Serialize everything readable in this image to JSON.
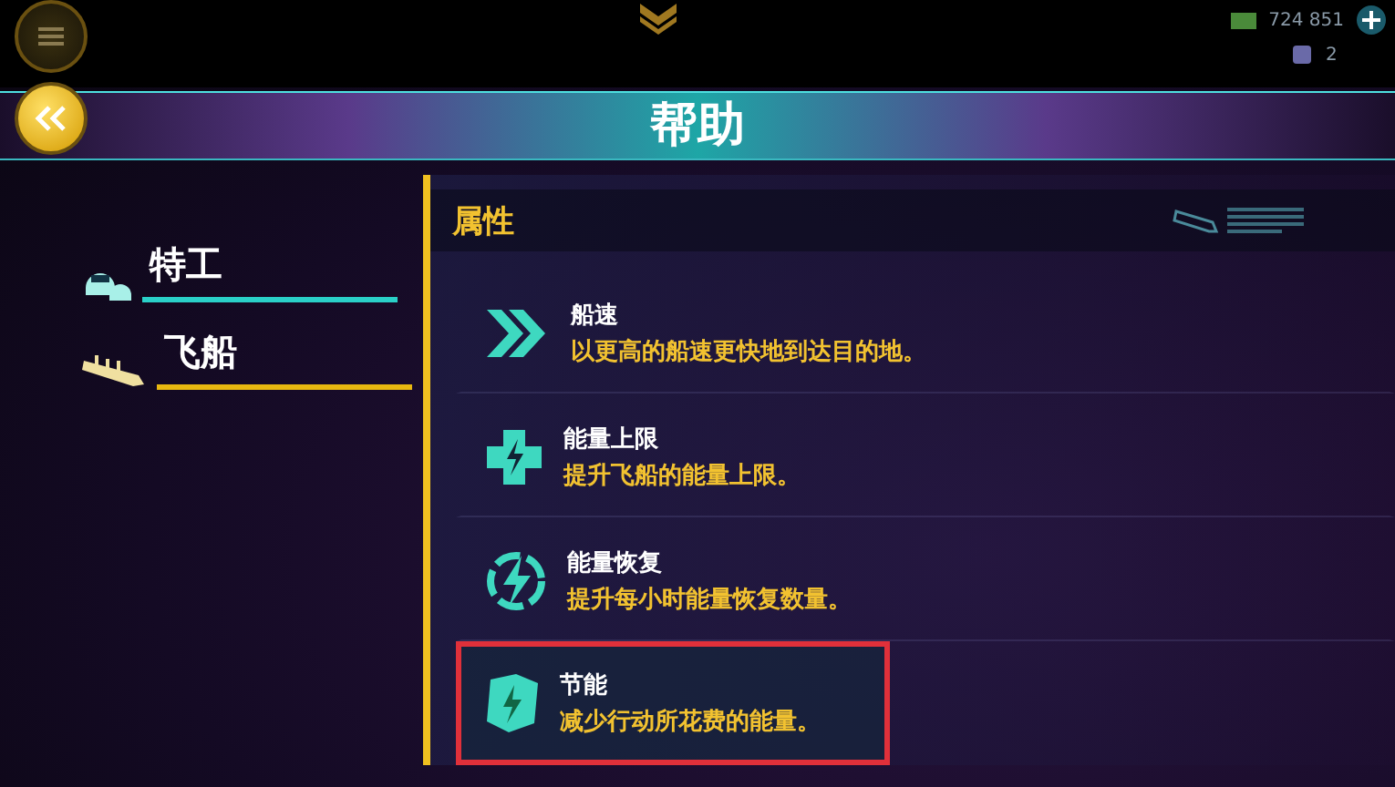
{
  "top_bar": {
    "credits": "724 851",
    "tickets": "2"
  },
  "title": "帮助",
  "sidebar": {
    "items": [
      {
        "label": "特工",
        "kind": "agent",
        "selected": false
      },
      {
        "label": "飞船",
        "kind": "ship",
        "selected": true
      }
    ]
  },
  "section": {
    "title": "属性",
    "items": [
      {
        "kind": "speed",
        "name": "船速",
        "description": "以更高的船速更快地到达目的地。",
        "highlighted": false
      },
      {
        "kind": "capacity",
        "name": "能量上限",
        "description": "提升飞船的能量上限。",
        "highlighted": false
      },
      {
        "kind": "recovery",
        "name": "能量恢复",
        "description": "提升每小时能量恢复数量。",
        "highlighted": false
      },
      {
        "kind": "saving",
        "name": "节能",
        "description": "减少行动所花费的能量。",
        "highlighted": true
      }
    ]
  }
}
